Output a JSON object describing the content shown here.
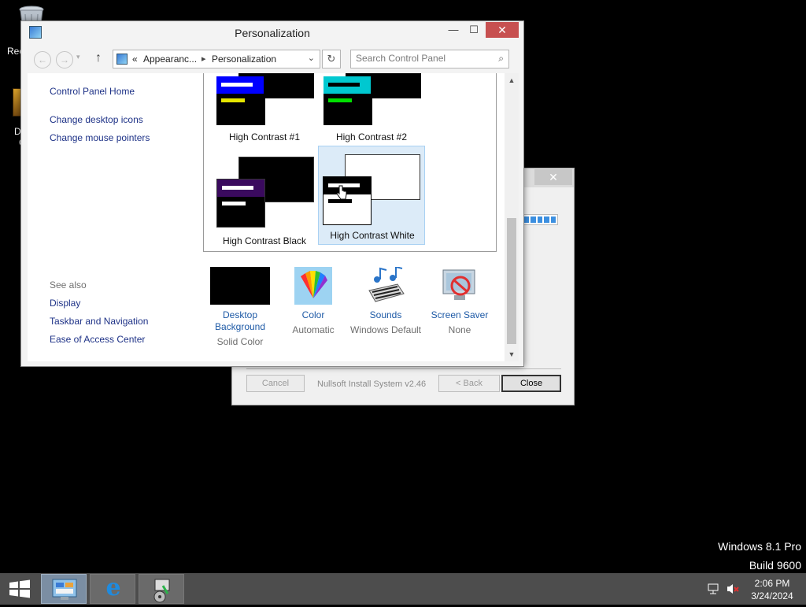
{
  "desktop": {
    "recycle_label": "Rec",
    "desk2_label_line1": "D",
    "desk2_label_line2": "C",
    "watermark_line1": "Windows 8.1 Pro",
    "watermark_line2": "Build 9600"
  },
  "installer": {
    "cancel_label": "Cancel",
    "brand": "Nullsoft Install System v2.46",
    "back_label": "< Back",
    "close_label": "Close",
    "title_close": "✕"
  },
  "window": {
    "title": "Personalization",
    "min_glyph": "—",
    "max_glyph": "☐",
    "close_glyph": "✕"
  },
  "nav": {
    "back_glyph": "←",
    "forward_glyph": "→",
    "dropdown_glyph": "▾",
    "up_glyph": "↑",
    "breadcrumb_overflow": "«",
    "breadcrumb_1": "Appearanc...",
    "breadcrumb_sep": "▸",
    "breadcrumb_2": "Personalization",
    "address_chevron": "⌄",
    "refresh_glyph": "↻",
    "search_placeholder": "Search Control Panel",
    "search_glyph": "⌕"
  },
  "sidebar": {
    "home": "Control Panel Home",
    "link1": "Change desktop icons",
    "link2": "Change mouse pointers",
    "see_also": "See also",
    "see1": "Display",
    "see2": "Taskbar and Navigation",
    "see3": "Ease of Access Center"
  },
  "themes": [
    {
      "name": "High Contrast #1",
      "back_color": "#000000",
      "front_color": "#000000",
      "header_color": "#0000ff",
      "bar1_color": "#ffffff",
      "bar2_color": "#e6e600"
    },
    {
      "name": "High Contrast #2",
      "back_color": "#000000",
      "front_color": "#000000",
      "header_color": "#00c8d0",
      "bar1_color": "#000000",
      "bar2_color": "#00e000"
    },
    {
      "name": "High Contrast Black",
      "back_color": "#000000",
      "front_color": "#000000",
      "header_color": "#3a0a5e",
      "bar1_color": "#ffffff",
      "bar2_color": "#ffffff"
    },
    {
      "name": "High Contrast White",
      "back_color": "#ffffff",
      "front_color": "#ffffff",
      "header_color": "#000000",
      "bar1_color": "#ffffff",
      "bar2_color": "#000000",
      "selected": true
    }
  ],
  "settings": [
    {
      "label_line1": "Desktop",
      "label_line2": "Background",
      "value": "Solid Color",
      "icon": "desktop-background-icon"
    },
    {
      "label_line1": "Color",
      "label_line2": "",
      "value": "Automatic",
      "icon": "color-icon"
    },
    {
      "label_line1": "Sounds",
      "label_line2": "",
      "value": "Windows Default",
      "icon": "sounds-icon"
    },
    {
      "label_line1": "Screen Saver",
      "label_line2": "",
      "value": "None",
      "icon": "screen-saver-icon"
    }
  ],
  "scroll": {
    "up_glyph": "▲",
    "down_glyph": "▼"
  },
  "taskbar": {
    "time": "2:06 PM",
    "date": "3/24/2024",
    "ie_glyph": "e"
  }
}
